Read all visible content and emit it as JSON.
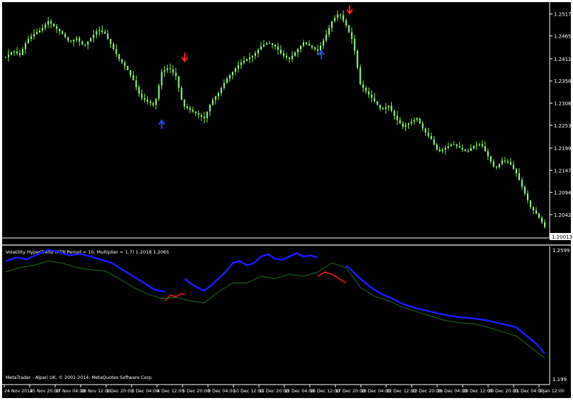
{
  "colors": {
    "background": "#000000",
    "candle": "#7CFC00",
    "candle_body": "#98ff98",
    "axis_text": "#ffffff",
    "separator": "#9a9a9a",
    "trend_up": "#1a1aff",
    "trend_down": "#ff1a1a",
    "secondary_line": "#1f6b1f",
    "arrow_up": "#2244ff",
    "arrow_down": "#ff2222"
  },
  "main_panel": {
    "price_labels": [
      "1.25170",
      "1.24650",
      "1.24110",
      "1.23585",
      "1.23060",
      "1.22535",
      "1.21995",
      "1.21470",
      "1.20945",
      "1.20420",
      "1.20013"
    ],
    "current_price": "1.20013"
  },
  "indicator_panel": {
    "title": "Volatility HyperTrend (ATR Period = 10, Multiplier = 1.7) 1.2018 1.2065",
    "scale_top": "1.2599",
    "scale_bottom": "1.199",
    "copyright": "MetaTrader - Alpari UK, © 2001-2014. MetaQuotes Software Corp."
  },
  "time_axis": {
    "labels": [
      "24 Nov 2014",
      "25 Nov 20:00",
      "27 Nov 04:00",
      "28 Nov 12:00",
      "1 Dec 20:00",
      "3 Dec 04:00",
      "4 Dec 12:00",
      "5 Dec 20:00",
      "9 Dec 04:00",
      "10 Dec 12:00",
      "11 Dec 20:00",
      "15 Dec 04:00",
      "16 Dec 12:00",
      "17 Dec 20:00",
      "19 Dec 04:00",
      "22 Dec 12:00",
      "23 Dec 20:00",
      "26 Dec 04:00",
      "29 Dec 12:00",
      "30 Dec 20:00",
      "31 Dec 04:00",
      "2 Jan 12:00"
    ]
  },
  "chart_data": [
    {
      "type": "candlestick",
      "title": "",
      "ylim": [
        1.199,
        1.254
      ],
      "x_ticks": [
        "24 Nov 2014",
        "25 Nov 20:00",
        "27 Nov 04:00",
        "28 Nov 12:00",
        "1 Dec 20:00",
        "3 Dec 04:00",
        "4 Dec 12:00",
        "5 Dec 20:00",
        "9 Dec 04:00",
        "10 Dec 12:00",
        "11 Dec 20:00",
        "15 Dec 04:00",
        "16 Dec 12:00",
        "17 Dec 20:00",
        "19 Dec 04:00",
        "22 Dec 12:00",
        "23 Dec 20:00",
        "26 Dec 04:00",
        "29 Dec 12:00",
        "30 Dec 20:00",
        "31 Dec 04:00",
        "2 Jan 12:00"
      ],
      "y_ticks": [
        1.2517,
        1.2465,
        1.2411,
        1.23585,
        1.2306,
        1.22535,
        1.21995,
        1.2147,
        1.20945,
        1.2042,
        1.20013
      ],
      "close_path": [
        [
          0,
          1.2415
        ],
        [
          4,
          1.243
        ],
        [
          8,
          1.242
        ],
        [
          12,
          1.2455
        ],
        [
          16,
          1.247
        ],
        [
          20,
          1.248
        ],
        [
          24,
          1.25
        ],
        [
          28,
          1.2485
        ],
        [
          32,
          1.247
        ],
        [
          36,
          1.245
        ],
        [
          40,
          1.246
        ],
        [
          44,
          1.244
        ],
        [
          48,
          1.246
        ],
        [
          52,
          1.248
        ],
        [
          56,
          1.247
        ],
        [
          60,
          1.244
        ],
        [
          64,
          1.241
        ],
        [
          68,
          1.239
        ],
        [
          72,
          1.236
        ],
        [
          76,
          1.232
        ],
        [
          80,
          1.231
        ],
        [
          84,
          1.23
        ],
        [
          88,
          1.238
        ],
        [
          92,
          1.239
        ],
        [
          96,
          1.237
        ],
        [
          100,
          1.23
        ],
        [
          104,
          1.229
        ],
        [
          108,
          1.228
        ],
        [
          112,
          1.227
        ],
        [
          116,
          1.231
        ],
        [
          120,
          1.233
        ],
        [
          124,
          1.236
        ],
        [
          128,
          1.238
        ],
        [
          132,
          1.24
        ],
        [
          136,
          1.241
        ],
        [
          140,
          1.242
        ],
        [
          144,
          1.244
        ],
        [
          148,
          1.245
        ],
        [
          152,
          1.244
        ],
        [
          156,
          1.242
        ],
        [
          160,
          1.241
        ],
        [
          164,
          1.243
        ],
        [
          168,
          1.245
        ],
        [
          172,
          1.244
        ],
        [
          176,
          1.243
        ],
        [
          180,
          1.246
        ],
        [
          184,
          1.25
        ],
        [
          188,
          1.252
        ],
        [
          192,
          1.249
        ],
        [
          196,
          1.245
        ],
        [
          200,
          1.235
        ],
        [
          204,
          1.233
        ],
        [
          208,
          1.231
        ],
        [
          212,
          1.229
        ],
        [
          216,
          1.23
        ],
        [
          220,
          1.227
        ],
        [
          224,
          1.225
        ],
        [
          228,
          1.226
        ],
        [
          232,
          1.227
        ],
        [
          236,
          1.224
        ],
        [
          240,
          1.222
        ],
        [
          244,
          1.219
        ],
        [
          248,
          1.22
        ],
        [
          252,
          1.221
        ],
        [
          256,
          1.22
        ],
        [
          260,
          1.219
        ],
        [
          264,
          1.2205
        ],
        [
          268,
          1.221
        ],
        [
          272,
          1.218
        ],
        [
          276,
          1.215
        ],
        [
          280,
          1.217
        ],
        [
          284,
          1.2165
        ],
        [
          288,
          1.214
        ],
        [
          292,
          1.21
        ],
        [
          296,
          1.206
        ],
        [
          300,
          1.204
        ],
        [
          304,
          1.2013
        ]
      ],
      "arrows": [
        {
          "dir": "up",
          "x": 88,
          "price": 1.2255
        },
        {
          "dir": "down",
          "x": 101,
          "price": 1.2415
        },
        {
          "dir": "up",
          "x": 178,
          "price": 1.242
        },
        {
          "dir": "down",
          "x": 194,
          "price": 1.2528
        }
      ]
    },
    {
      "type": "line",
      "title": "Volatility HyperTrend (ATR Period = 10, Multiplier = 1.7) 1.2018 1.2065",
      "ylim": [
        1.199,
        1.2599
      ],
      "series": [
        {
          "values": [
            [
              0,
              1.254
            ],
            [
              6,
              1.2555
            ],
            [
              12,
              1.2548
            ],
            [
              18,
              1.257
            ],
            [
              24,
              1.259
            ],
            [
              30,
              1.258
            ],
            [
              36,
              1.2565
            ],
            [
              42,
              1.2572
            ],
            [
              48,
              1.256
            ],
            [
              54,
              1.2545
            ],
            [
              60,
              1.253
            ],
            [
              66,
              1.25
            ],
            [
              72,
              1.247
            ],
            [
              78,
              1.244
            ],
            [
              84,
              1.241
            ],
            [
              90,
              1.24
            ]
          ]
        },
        {
          "values": [
            [
              90,
              1.236
            ],
            [
              93,
              1.2385
            ],
            [
              96,
              1.2378
            ],
            [
              99,
              1.2392
            ],
            [
              101,
              1.2388
            ]
          ]
        },
        {
          "values": [
            [
              101,
              1.246
            ],
            [
              104,
              1.244
            ],
            [
              108,
              1.242
            ],
            [
              112,
              1.2405
            ],
            [
              116,
              1.243
            ],
            [
              120,
              1.246
            ],
            [
              124,
              1.249
            ],
            [
              128,
              1.253
            ],
            [
              132,
              1.254
            ],
            [
              136,
              1.252
            ],
            [
              140,
              1.253
            ],
            [
              144,
              1.256
            ],
            [
              148,
              1.257
            ],
            [
              152,
              1.255
            ],
            [
              156,
              1.2545
            ],
            [
              160,
              1.256
            ],
            [
              164,
              1.2575
            ],
            [
              168,
              1.256
            ],
            [
              172,
              1.2565
            ],
            [
              176,
              1.2555
            ]
          ]
        },
        {
          "values": [
            [
              176,
              1.247
            ],
            [
              180,
              1.249
            ],
            [
              184,
              1.248
            ],
            [
              188,
              1.246
            ],
            [
              192,
              1.244
            ]
          ]
        },
        {
          "values": [
            [
              192,
              1.252
            ],
            [
              196,
              1.249
            ],
            [
              200,
              1.246
            ],
            [
              206,
              1.242
            ],
            [
              212,
              1.239
            ],
            [
              218,
              1.237
            ],
            [
              224,
              1.2345
            ],
            [
              232,
              1.2325
            ],
            [
              240,
              1.231
            ],
            [
              248,
              1.2295
            ],
            [
              256,
              1.2285
            ],
            [
              264,
              1.228
            ],
            [
              272,
              1.227
            ],
            [
              280,
              1.2255
            ],
            [
              288,
              1.224
            ],
            [
              294,
              1.22
            ],
            [
              300,
              1.216
            ],
            [
              304,
              1.212
            ]
          ]
        },
        {
          "values": [
            [
              0,
              1.249
            ],
            [
              8,
              1.251
            ],
            [
              16,
              1.252
            ],
            [
              24,
              1.254
            ],
            [
              32,
              1.253
            ],
            [
              40,
              1.251
            ],
            [
              48,
              1.25
            ],
            [
              56,
              1.2495
            ],
            [
              64,
              1.246
            ],
            [
              72,
              1.242
            ],
            [
              80,
              1.239
            ],
            [
              88,
              1.237
            ],
            [
              96,
              1.2375
            ],
            [
              104,
              1.236
            ],
            [
              112,
              1.235
            ],
            [
              120,
              1.24
            ],
            [
              128,
              1.244
            ],
            [
              136,
              1.244
            ],
            [
              144,
              1.247
            ],
            [
              152,
              1.246
            ],
            [
              160,
              1.248
            ],
            [
              168,
              1.247
            ],
            [
              176,
              1.249
            ],
            [
              184,
              1.253
            ],
            [
              192,
              1.251
            ],
            [
              200,
              1.242
            ],
            [
              208,
              1.238
            ],
            [
              216,
              1.236
            ],
            [
              224,
              1.233
            ],
            [
              232,
              1.231
            ],
            [
              240,
              1.229
            ],
            [
              248,
              1.227
            ],
            [
              256,
              1.226
            ],
            [
              264,
              1.2255
            ],
            [
              272,
              1.224
            ],
            [
              280,
              1.222
            ],
            [
              288,
              1.22
            ],
            [
              296,
              1.215
            ],
            [
              304,
              1.21
            ]
          ]
        }
      ]
    }
  ]
}
